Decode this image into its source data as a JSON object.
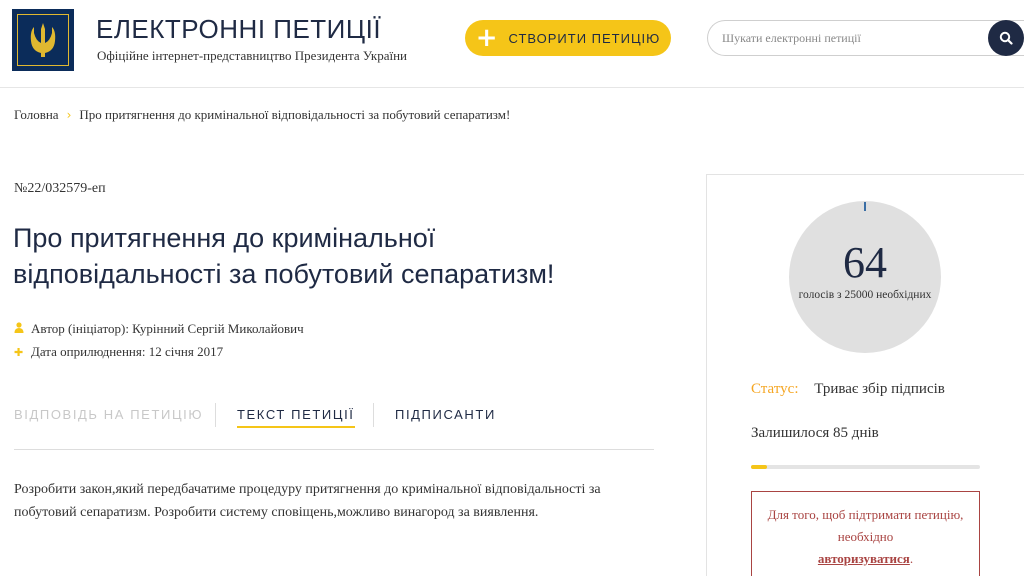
{
  "header": {
    "title": "ЕЛЕКТРОННІ ПЕТИЦІЇ",
    "subtitle": "Офіційне інтернет-представництво Президента України",
    "create_label": "СТВОРИТИ ПЕТИЦІЮ",
    "search_placeholder": "Шукати електронні петиції"
  },
  "breadcrumb": {
    "home": "Головна",
    "current": "Про притягнення до кримінальної відповідальності за побутовий сепаратизм!"
  },
  "petition": {
    "number": "№22/032579-еп",
    "title": "Про притягнення до кримінальної відповідальності за побутовий сепаратизм!",
    "author": "Автор (ініціатор): Курінний Сергій Миколайович",
    "date": "Дата оприлюднення: 12 січня 2017",
    "tabs": [
      "ВІДПОВІДЬ НА ПЕТИЦІЮ",
      "ТЕКСТ ПЕТИЦІЇ",
      "ПІДПИСАНТИ"
    ],
    "body": "Розробити закон,який передбачатиме процедуру притягнення до кримінальної відповідальності за побутовий сепаратизм. Розробити систему сповіщень,можливо винагород за виявлення."
  },
  "sidebar": {
    "votes": "64",
    "votes_sub": "голосів з 25000 необхідних",
    "status_label": "Статус:",
    "status_value": "Триває збір підписів",
    "remaining": "Залишилося 85 днів",
    "progress": 0.07,
    "auth_text_1": "Для того, щоб підтримати петицію, необхідно",
    "auth_link": "авторизуватися",
    "auth_text_2": "."
  },
  "colors": {
    "accent": "#f5c518",
    "navy": "#1f2a44",
    "status_label": "#f5a623",
    "warning": "#a94442"
  },
  "icons": {
    "logo": "trident-icon",
    "create": "plus-icon",
    "search": "search-icon",
    "author": "person-icon",
    "date": "plus-icon"
  }
}
